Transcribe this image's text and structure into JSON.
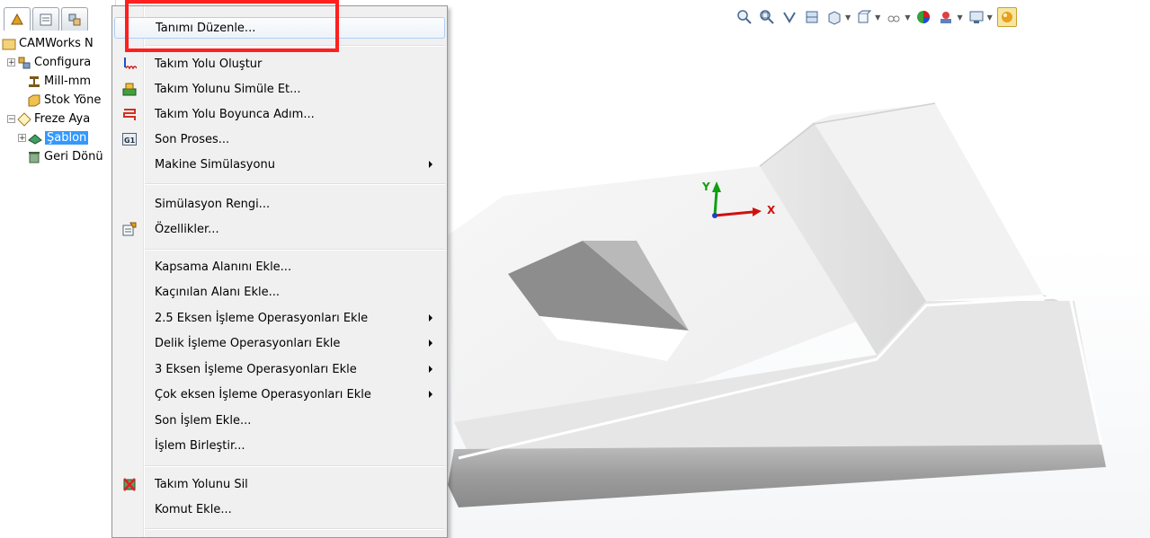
{
  "feature_tree": {
    "items": [
      {
        "label": "CAMWorks N",
        "icon": "camworks-nc-icon",
        "expander": ""
      },
      {
        "label": "Configura",
        "icon": "configuration-icon",
        "expander": "+"
      },
      {
        "label": "Mill-mm",
        "icon": "machine-icon",
        "expander": ""
      },
      {
        "label": "Stok Yöne",
        "icon": "stock-manager-icon",
        "expander": ""
      },
      {
        "label": "Freze Aya",
        "icon": "mill-setup-icon",
        "expander": "-"
      },
      {
        "label": "Şablon",
        "icon": "pattern-feature-icon",
        "expander": "+"
      },
      {
        "label": "Geri Dönü",
        "icon": "recycle-bin-icon",
        "expander": ""
      }
    ]
  },
  "context_menu": {
    "items": [
      {
        "label": "Tanımı Düzenle...",
        "icon": "",
        "submenu": false,
        "hover": true
      },
      {
        "label": "Takım Yolu Oluştur",
        "icon": "generate-toolpath-icon",
        "submenu": false
      },
      {
        "label": "Takım Yolunu Simüle Et...",
        "icon": "simulate-toolpath-icon",
        "submenu": false
      },
      {
        "label": "Takım Yolu Boyunca Adım...",
        "icon": "step-through-toolpath-icon",
        "submenu": false
      },
      {
        "label": "Son Proses...",
        "icon": "post-process-g1-icon",
        "submenu": false
      },
      {
        "label": "Makine Simülasyonu",
        "icon": "",
        "submenu": true
      },
      {
        "label": "Simülasyon Rengi...",
        "icon": "",
        "submenu": false
      },
      {
        "label": "Özellikler...",
        "icon": "properties-icon",
        "submenu": false
      },
      {
        "label": "Kapsama Alanını Ekle...",
        "icon": "",
        "submenu": false
      },
      {
        "label": "Kaçınılan Alanı Ekle...",
        "icon": "",
        "submenu": false
      },
      {
        "label": "2.5 Eksen İşleme Operasyonları Ekle",
        "icon": "",
        "submenu": true
      },
      {
        "label": "Delik İşleme Operasyonları Ekle",
        "icon": "",
        "submenu": true
      },
      {
        "label": "3 Eksen İşleme Operasyonları Ekle",
        "icon": "",
        "submenu": true
      },
      {
        "label": "Çok eksen  İşleme Operasyonları Ekle",
        "icon": "",
        "submenu": true
      },
      {
        "label": "Son İşlem Ekle...",
        "icon": "",
        "submenu": false
      },
      {
        "label": "İşlem Birleştir...",
        "icon": "",
        "submenu": false
      },
      {
        "label": "Takım Yolunu Sil",
        "icon": "delete-toolpath-icon",
        "submenu": false
      },
      {
        "label": "Komut Ekle...",
        "icon": "",
        "submenu": false
      }
    ]
  },
  "triad": {
    "x_label": "X",
    "y_label": "Y"
  },
  "colors": {
    "highlight": "#ff1f1f",
    "selection": "#3399ff",
    "x_axis": "#d01010",
    "y_axis": "#10a010"
  }
}
